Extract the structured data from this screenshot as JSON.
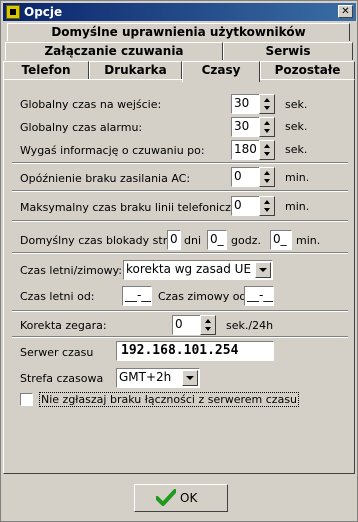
{
  "window": {
    "title": "Opcje",
    "close_glyph": "✕"
  },
  "tabs": {
    "row1": [
      "Domyślne uprawnienia użytkowników"
    ],
    "row2": [
      "Załączanie czuwania",
      "Serwis"
    ],
    "row3": [
      "Telefon",
      "Drukarka",
      "Czasy",
      "Pozostałe"
    ],
    "active": "Czasy"
  },
  "times": {
    "entry_label": "Globalny czas na wejście:",
    "entry_value": "30",
    "entry_unit": "sek.",
    "alarm_label": "Globalny czas alarmu:",
    "alarm_value": "30",
    "alarm_unit": "sek.",
    "expire_label": "Wygaś informację o czuwaniu po:",
    "expire_value": "180",
    "expire_unit": "sek.",
    "ac_label": "Opóźnienie braku zasilania AC:",
    "ac_value": "0",
    "ac_unit": "min.",
    "phone_label": "Maksymalny czas braku linii telefonicznej:",
    "phone_value": "0",
    "phone_unit": "min."
  },
  "blockade": {
    "label": "Domyślny czas blokady stref:",
    "days_value": "0",
    "days_unit": "dni",
    "hours_value": "0_",
    "hours_unit": "godz.",
    "minutes_value": "0_",
    "minutes_unit": "min."
  },
  "dst": {
    "label": "Czas letni/zimowy:",
    "selected": "korekta wg zasad UE",
    "summer_label": "Czas letni od:",
    "summer_value": "__-__",
    "winter_label": "Czas zimowy od:",
    "winter_value": "__-__"
  },
  "clock": {
    "label": "Korekta zegara:",
    "value": "0",
    "unit": "sek./24h"
  },
  "server": {
    "label": "Serwer czasu",
    "value": "192.168.101.254"
  },
  "timezone": {
    "label": "Strefa czasowa",
    "selected": "GMT+2h"
  },
  "noreport": {
    "label": "Nie zgłaszaj braku łączności z serwerem czasu",
    "checked": false
  },
  "ok_button": {
    "label": "OK"
  },
  "colors": {
    "titlebar_start": "#0a246a",
    "titlebar_end": "#3a6ea5",
    "ok_check": "#1e9a1e"
  }
}
